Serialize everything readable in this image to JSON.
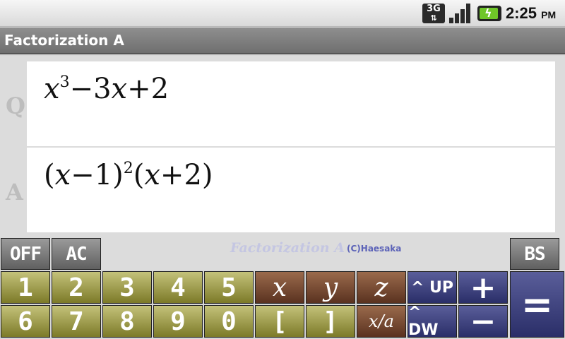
{
  "status_bar": {
    "network": "3G",
    "network_arrows": "⇅",
    "time": "2:25",
    "ampm": "PM"
  },
  "app_title": "Factorization A",
  "display": {
    "q_label": "Q",
    "a_label": "A",
    "question": {
      "x": "x",
      "exp3": "3",
      "rest": "−3",
      "x2": "x",
      "tail": "+2"
    },
    "answer": {
      "open1": "(",
      "x": "x",
      "mid1": "−1)",
      "exp2": "2",
      "open2": "(",
      "x2": "x",
      "tail": "+2)"
    }
  },
  "function_row": {
    "off": "OFF",
    "ac": "AC",
    "watermark": "Factorization A",
    "copyright": "(C)Haesaka",
    "bs": "BS"
  },
  "keypad": {
    "row1_digits": [
      "1",
      "2",
      "3",
      "4",
      "5"
    ],
    "row2_digits": [
      "6",
      "7",
      "8",
      "9",
      "0"
    ],
    "open_bracket": "[",
    "close_bracket": "]",
    "var_x": "x",
    "var_y": "y",
    "var_z": "z",
    "x_over_a": "x/a",
    "up": "^ UP",
    "down": "^ DW",
    "plus": "+",
    "minus": "−",
    "equals": "="
  },
  "colors": {
    "olive_key": "#9c9a44",
    "brown_key": "#7a4a32",
    "navy_key": "#3c4080",
    "gray_key": "#7c7c7c",
    "battery": "#6fc628"
  }
}
